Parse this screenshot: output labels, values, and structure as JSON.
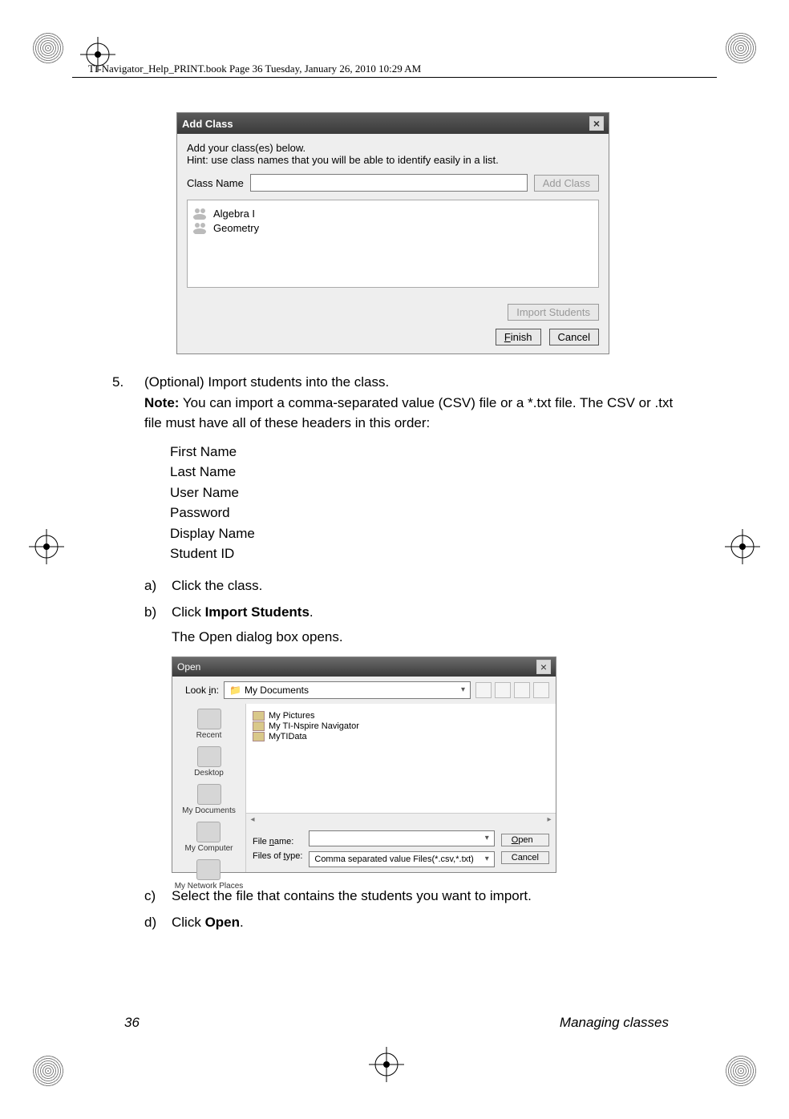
{
  "header": {
    "text": "TI-Navigator_Help_PRINT.book  Page 36  Tuesday, January 26, 2010  10:29 AM"
  },
  "addClassDialog": {
    "title": "Add Class",
    "instruction1": "Add your class(es) below.",
    "instruction2": "Hint: use class names that you will be able to identify easily in a list.",
    "classNameLabel": "Class Name",
    "addClassBtn": "Add Class",
    "classes": [
      "Algebra I",
      "Geometry"
    ],
    "importBtn": "Import Students",
    "finishBtn": "Finish",
    "cancelBtn": "Cancel"
  },
  "step5": {
    "num": "5.",
    "text1": "(Optional) Import students into the class.",
    "noteLabel": "Note:",
    "noteText": " You can import a comma-separated value (CSV) file or a *.txt file. The CSV or .txt file must have all of these headers in this order:"
  },
  "csvHeaders": [
    "First Name",
    "Last Name",
    "User Name",
    "Password",
    "Display Name",
    "Student ID"
  ],
  "subA": {
    "lbl": "a)",
    "text": "Click the class."
  },
  "subB": {
    "lbl": "b)",
    "text1": "Click ",
    "bold": "Import Students",
    "text2": "."
  },
  "subBDesc": "The Open dialog box opens.",
  "openDialog": {
    "title": "Open",
    "lookInLabel": "Look in:",
    "lookInValue": "My Documents",
    "places": [
      "Recent",
      "Desktop",
      "My Documents",
      "My Computer",
      "My Network Places"
    ],
    "folders": [
      "My Pictures",
      "My TI-Nspire Navigator",
      "MyTIData"
    ],
    "fileNameLabel": "File name:",
    "fileNameValue": "",
    "filesOfTypeLabel": "Files of type:",
    "filesOfTypeValue": "Comma separated value Files(*.csv,*.txt)",
    "openBtn": "Open",
    "cancelBtn": "Cancel"
  },
  "subC": {
    "lbl": "c)",
    "text": "Select the file that contains the students you want to import."
  },
  "subD": {
    "lbl": "d)",
    "text1": "Click ",
    "bold": "Open",
    "text2": "."
  },
  "footer": {
    "pageNum": "36",
    "section": "Managing classes"
  }
}
